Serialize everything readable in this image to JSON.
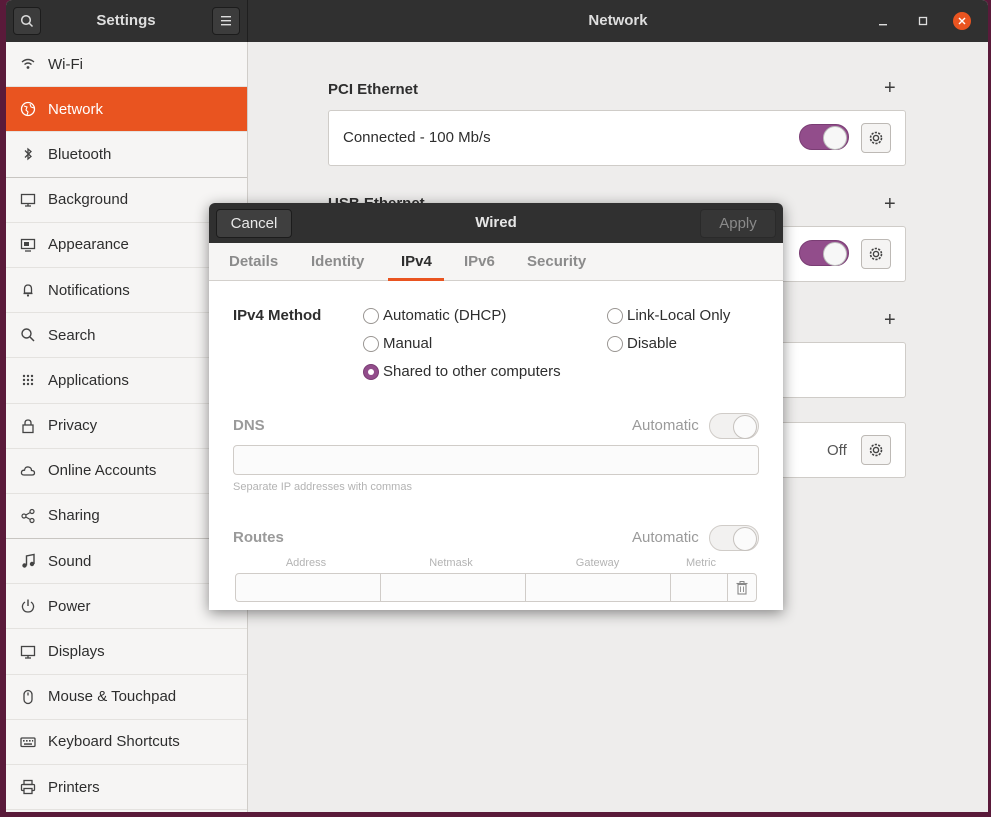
{
  "window": {
    "sidebar_title": "Settings",
    "main_title": "Network"
  },
  "sidebar": {
    "items": [
      {
        "label": "Wi-Fi",
        "icon": "wifi-icon"
      },
      {
        "label": "Network",
        "icon": "network-icon",
        "active": true
      },
      {
        "label": "Bluetooth",
        "icon": "bluetooth-icon"
      },
      {
        "label": "Background",
        "icon": "background-icon"
      },
      {
        "label": "Appearance",
        "icon": "appearance-icon"
      },
      {
        "label": "Notifications",
        "icon": "bell-icon"
      },
      {
        "label": "Search",
        "icon": "search-icon"
      },
      {
        "label": "Applications",
        "icon": "grid-icon"
      },
      {
        "label": "Privacy",
        "icon": "lock-icon"
      },
      {
        "label": "Online Accounts",
        "icon": "cloud-icon"
      },
      {
        "label": "Sharing",
        "icon": "share-icon"
      },
      {
        "label": "Sound",
        "icon": "music-note-icon"
      },
      {
        "label": "Power",
        "icon": "power-icon"
      },
      {
        "label": "Displays",
        "icon": "display-icon"
      },
      {
        "label": "Mouse & Touchpad",
        "icon": "mouse-icon"
      },
      {
        "label": "Keyboard Shortcuts",
        "icon": "keyboard-icon"
      },
      {
        "label": "Printers",
        "icon": "printer-icon"
      }
    ]
  },
  "main": {
    "pci_title": "PCI Ethernet",
    "pci_status": "Connected - 100 Mb/s",
    "usb_title": "USB Ethernet",
    "off_label": "Off"
  },
  "dialog": {
    "cancel": "Cancel",
    "title": "Wired",
    "apply": "Apply",
    "tabs": [
      "Details",
      "Identity",
      "IPv4",
      "IPv6",
      "Security"
    ],
    "active_tab": "IPv4",
    "method_label": "IPv4 Method",
    "methods": {
      "automatic": "Automatic (DHCP)",
      "link_local": "Link-Local Only",
      "manual": "Manual",
      "disable": "Disable",
      "shared": "Shared to other computers"
    },
    "selected_method": "Shared to other computers",
    "dns_label": "DNS",
    "automatic_label": "Automatic",
    "dns_hint": "Separate IP addresses with commas",
    "routes_label": "Routes",
    "route_columns": [
      "Address",
      "Netmask",
      "Gateway",
      "Metric"
    ]
  },
  "colors": {
    "accent": "#e95420",
    "toggle_on": "#924d8b",
    "header": "#303030"
  }
}
